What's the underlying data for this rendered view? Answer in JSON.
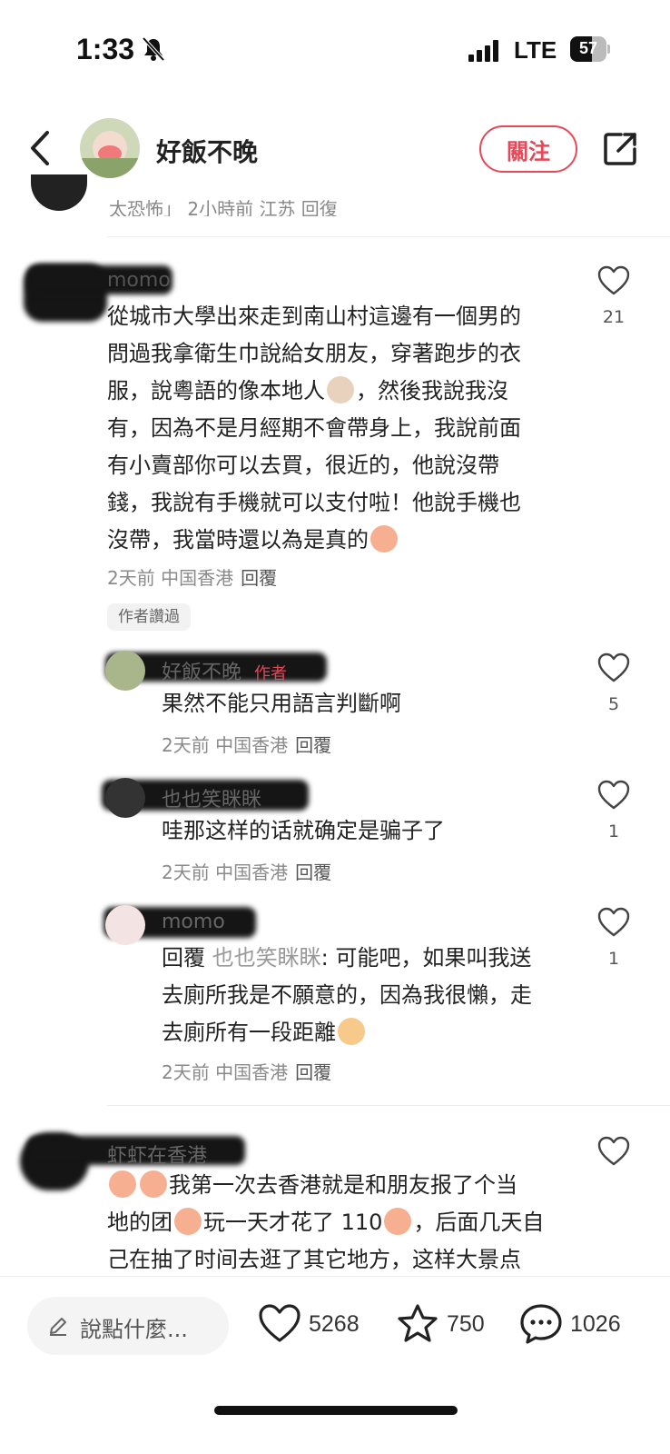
{
  "status_bar": {
    "time": "1:33",
    "network": "LTE",
    "battery": "57"
  },
  "header": {
    "author_name": "好飯不晚",
    "follow_label": "關注"
  },
  "partial_comment": {
    "text": "太恐怖」 2小時前 江苏 回復"
  },
  "comments": [
    {
      "username": "momo",
      "lines": [
        "從城市大學出來走到南山村這邊有一個男的",
        "問過我拿衛生巾說給女朋友，穿著跑步的衣",
        "服，說粵語的像本地人",
        "，然後我說我沒",
        "有，因為不是月經期不會帶身上，我說前面",
        "有小賣部你可以去買，很近的，他說沒帶",
        "錢，我說有手機就可以支付啦！他說手機也",
        "沒帶，我當時還以為是真的"
      ],
      "time": "2天前",
      "location": "中国香港",
      "reply_label": "回覆",
      "likes": "21",
      "badge": "作者讚過"
    },
    {
      "username": "好飯不晚",
      "author_badge": "作者",
      "text": "果然不能只用語言判斷啊",
      "time": "2天前",
      "location": "中国香港",
      "reply_label": "回覆",
      "likes": "5"
    },
    {
      "username": "也也笑眯眯",
      "text": "哇那这样的话就确定是骗子了",
      "time": "2天前",
      "location": "中国香港",
      "reply_label": "回覆",
      "likes": "1"
    },
    {
      "username": "momo",
      "reply_prefix": "回覆",
      "reply_to": "也也笑眯眯",
      "text_1": ": 可能吧，如果叫我送",
      "text_2": "去廁所我是不願意的，因為我很懶，走",
      "text_3": "去廁所有一段距離",
      "time": "2天前",
      "location": "中国香港",
      "reply_label": "回覆",
      "likes": "1"
    },
    {
      "username": "虾虾在香港",
      "text_1": "我第一次去香港就是和朋友报了个当",
      "text_2a": "地的团",
      "text_2b": "玩一天才花了 110",
      "text_2c": "，后面几天自",
      "text_3": "己在抽了时间去逛了其它地方，这样大景点"
    }
  ],
  "bottom_bar": {
    "input_placeholder": "說點什麼...",
    "likes": "5268",
    "favorites": "750",
    "comments": "1026"
  },
  "colors": {
    "accent": "#e64759",
    "meta": "#8a8a8a"
  },
  "icons": [
    "back-arrow-icon",
    "share-icon",
    "heart-icon",
    "star-icon",
    "comment-bubble-icon",
    "pencil-icon",
    "bell-muted-icon"
  ]
}
